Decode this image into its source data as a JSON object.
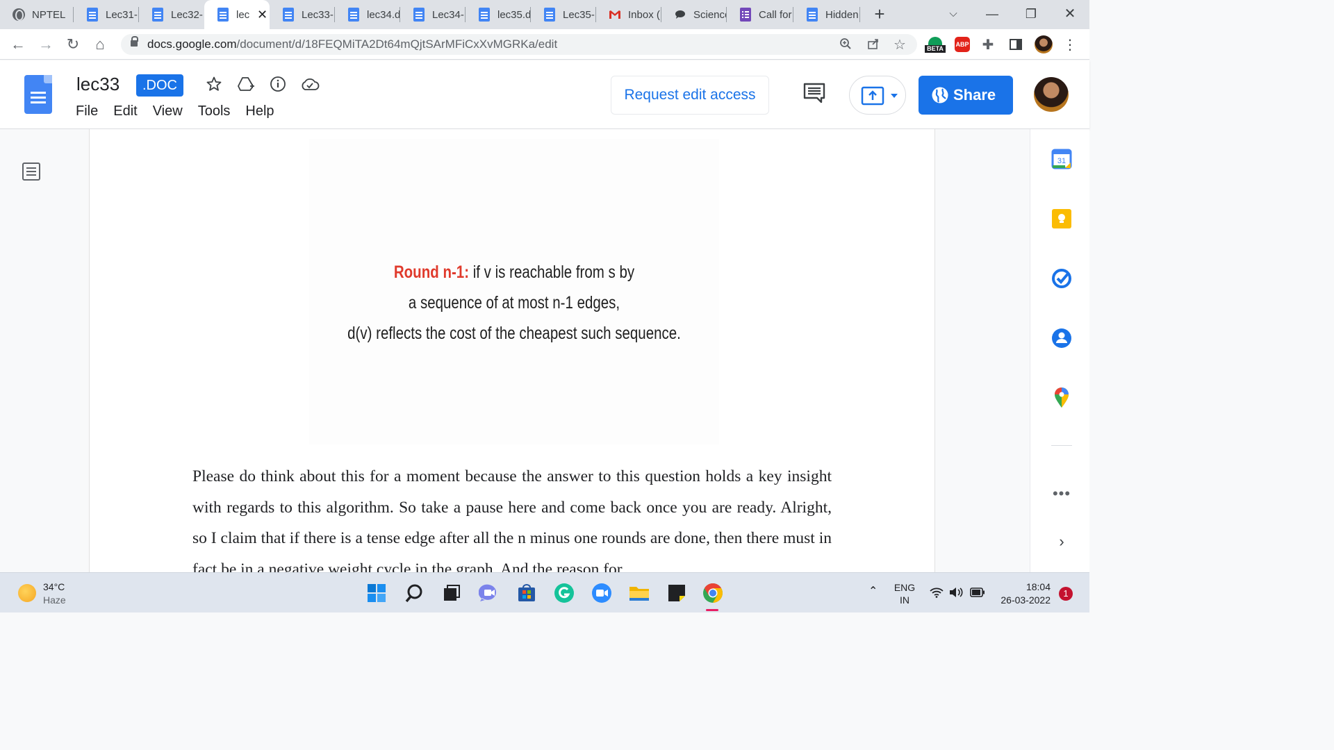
{
  "browser": {
    "tabs": [
      {
        "label": "NPTEL",
        "icon": "globe-icon",
        "active": false
      },
      {
        "label": "Lec31-",
        "icon": "docs-icon",
        "active": false
      },
      {
        "label": "Lec32-",
        "icon": "docs-icon",
        "active": false
      },
      {
        "label": "lec",
        "icon": "docs-icon",
        "active": true
      },
      {
        "label": "Lec33-",
        "icon": "docs-icon",
        "active": false
      },
      {
        "label": "lec34.d",
        "icon": "docs-icon",
        "active": false
      },
      {
        "label": "Lec34-",
        "icon": "docs-icon",
        "active": false
      },
      {
        "label": "lec35.d",
        "icon": "docs-icon",
        "active": false
      },
      {
        "label": "Lec35-",
        "icon": "docs-icon",
        "active": false
      },
      {
        "label": "Inbox (",
        "icon": "gmail-icon",
        "active": false
      },
      {
        "label": "Science",
        "icon": "chat-icon",
        "active": false
      },
      {
        "label": "Call for",
        "icon": "forms-icon",
        "active": false
      },
      {
        "label": "Hidden",
        "icon": "docs-icon",
        "active": false
      }
    ],
    "url_host": "docs.google.com",
    "url_path": "/document/d/18FEQMiTA2Dt64mQjtSArMFiCxXvMGRKa/edit",
    "extension_beta_label": "BETA",
    "extension_abp_label": "ABP"
  },
  "docs": {
    "title": "lec33",
    "badge": ".DOC",
    "menu": [
      "File",
      "Edit",
      "View",
      "Tools",
      "Help"
    ],
    "request_access_label": "Request edit access",
    "share_label": "Share"
  },
  "document": {
    "slide_heading": "Round n-1:",
    "slide_line1": " if v is reachable from s by",
    "slide_line2": "a sequence of at most n-1 edges,",
    "slide_line3": "d(v) reflects the cost of the cheapest such sequence.",
    "paragraph": "Please do think about this for a moment because the answer to this question holds a key insight with regards to this algorithm. So take a pause here and come back once you are ready. Alright, so I claim that if there is a tense edge after all the n minus one rounds are done, then there must in fact be in a negative weight cycle in the graph. And the reason for"
  },
  "side_panel": {
    "calendar_day": "31"
  },
  "taskbar": {
    "temperature": "34°C",
    "condition": "Haze",
    "lang_top": "ENG",
    "lang_bottom": "IN",
    "time": "18:04",
    "date": "26-03-2022",
    "notification_count": "1"
  }
}
